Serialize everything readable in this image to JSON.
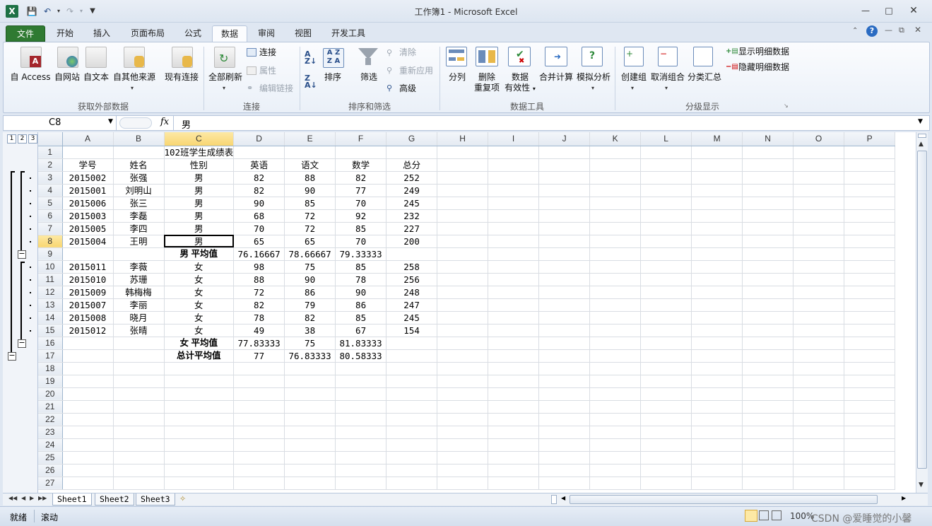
{
  "window": {
    "title": "工作簿1 - Microsoft Excel",
    "app_icon": "excel-icon"
  },
  "quick_access": {
    "save": "save-icon",
    "undo": "undo-icon",
    "redo": "redo-icon"
  },
  "tabs": [
    "文件",
    "开始",
    "插入",
    "页面布局",
    "公式",
    "数据",
    "审阅",
    "视图",
    "开发工具"
  ],
  "active_tab": "数据",
  "ribbon": {
    "groups": [
      {
        "label": "获取外部数据",
        "buttons": [
          "自 Access",
          "自网站",
          "自文本",
          "自其他来源",
          "现有连接"
        ]
      },
      {
        "label": "连接",
        "buttons": [
          "全部刷新",
          "连接",
          "属性",
          "编辑链接"
        ]
      },
      {
        "label": "排序和筛选",
        "buttons": [
          "排序",
          "筛选",
          "清除",
          "重新应用",
          "高级"
        ]
      },
      {
        "label": "数据工具",
        "buttons": [
          "分列",
          "删除",
          "重复项",
          "数据",
          "有效性",
          "合并计算",
          "模拟分析"
        ]
      },
      {
        "label": "分级显示",
        "buttons": [
          "创建组",
          "取消组合",
          "分类汇总",
          "显示明细数据",
          "隐藏明细数据"
        ]
      }
    ]
  },
  "formula_bar": {
    "name_box": "C8",
    "fx": "fx",
    "content": "男"
  },
  "outline_levels": [
    "1",
    "2",
    "3"
  ],
  "columns": [
    "A",
    "B",
    "C",
    "D",
    "E",
    "F",
    "G",
    "H",
    "I",
    "J",
    "K",
    "L",
    "M",
    "N",
    "O",
    "P"
  ],
  "rows": [
    {
      "n": "1",
      "c": [
        "",
        "",
        "102班学生成绩表",
        "",
        "",
        "",
        ""
      ]
    },
    {
      "n": "2",
      "c": [
        "学号",
        "姓名",
        "性别",
        "英语",
        "语文",
        "数学",
        "总分"
      ]
    },
    {
      "n": "3",
      "c": [
        "2015002",
        "张强",
        "男",
        "82",
        "88",
        "82",
        "252"
      ]
    },
    {
      "n": "4",
      "c": [
        "2015001",
        "刘明山",
        "男",
        "82",
        "90",
        "77",
        "249"
      ]
    },
    {
      "n": "5",
      "c": [
        "2015006",
        "张三",
        "男",
        "90",
        "85",
        "70",
        "245"
      ]
    },
    {
      "n": "6",
      "c": [
        "2015003",
        "李磊",
        "男",
        "68",
        "72",
        "92",
        "232"
      ]
    },
    {
      "n": "7",
      "c": [
        "2015005",
        "李四",
        "男",
        "70",
        "72",
        "85",
        "227"
      ]
    },
    {
      "n": "8",
      "c": [
        "2015004",
        "王明",
        "男",
        "65",
        "65",
        "70",
        "200"
      ]
    },
    {
      "n": "9",
      "c": [
        "",
        "",
        "男 平均值",
        "76.16667",
        "78.66667",
        "79.33333",
        ""
      ]
    },
    {
      "n": "10",
      "c": [
        "2015011",
        "李薇",
        "女",
        "98",
        "75",
        "85",
        "258"
      ]
    },
    {
      "n": "11",
      "c": [
        "2015010",
        "苏珊",
        "女",
        "88",
        "90",
        "78",
        "256"
      ]
    },
    {
      "n": "12",
      "c": [
        "2015009",
        "韩梅梅",
        "女",
        "72",
        "86",
        "90",
        "248"
      ]
    },
    {
      "n": "13",
      "c": [
        "2015007",
        "李丽",
        "女",
        "82",
        "79",
        "86",
        "247"
      ]
    },
    {
      "n": "14",
      "c": [
        "2015008",
        "晓月",
        "女",
        "78",
        "82",
        "85",
        "245"
      ]
    },
    {
      "n": "15",
      "c": [
        "2015012",
        "张晴",
        "女",
        "49",
        "38",
        "67",
        "154"
      ]
    },
    {
      "n": "16",
      "c": [
        "",
        "",
        "女 平均值",
        "77.83333",
        "75",
        "81.83333",
        ""
      ]
    },
    {
      "n": "17",
      "c": [
        "",
        "",
        "总计平均值",
        "77",
        "76.83333",
        "80.58333",
        ""
      ]
    },
    {
      "n": "18",
      "c": []
    },
    {
      "n": "19",
      "c": []
    },
    {
      "n": "20",
      "c": []
    },
    {
      "n": "21",
      "c": []
    },
    {
      "n": "22",
      "c": []
    },
    {
      "n": "23",
      "c": []
    },
    {
      "n": "24",
      "c": []
    },
    {
      "n": "25",
      "c": []
    },
    {
      "n": "26",
      "c": []
    },
    {
      "n": "27",
      "c": []
    }
  ],
  "sheets": [
    "Sheet1",
    "Sheet2",
    "Sheet3"
  ],
  "active_sheet": "Sheet1",
  "status": {
    "left1": "就绪",
    "left2": "滚动",
    "zoom": "100%"
  },
  "watermark": "CSDN @爱睡觉的小馨",
  "colors": {
    "accent": "#2f7a32",
    "selection_header": "#f8d672",
    "ribbon_border": "#b7c6dc"
  }
}
